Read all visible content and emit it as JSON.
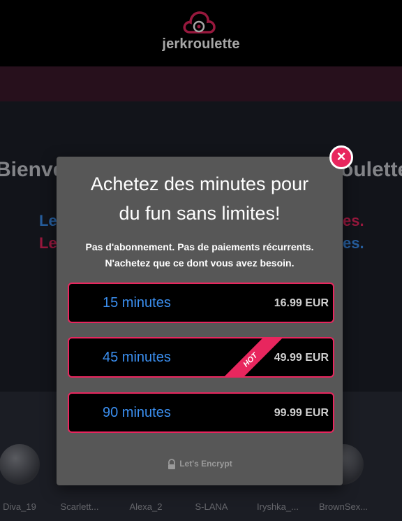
{
  "header": {
    "brand": "jerkroulette"
  },
  "background": {
    "welcome_left": "Bienve",
    "welcome_right": "oulette",
    "lines": [
      {
        "left": "Le",
        "right": "es.",
        "left_color": "#3b8ff0",
        "right_color": "#e8265e"
      },
      {
        "left": "Le",
        "right": "es.",
        "left_color": "#e8265e",
        "right_color": "#3b8ff0"
      }
    ],
    "performers": [
      "Diva_19",
      "Scarlett...",
      "Alexa_2",
      "S-LANA",
      "Iryshka_...",
      "BrownSex..."
    ]
  },
  "modal": {
    "title_line1": "Achetez des minutes pour",
    "title_line2": "du fun sans limites!",
    "subtitle_line1": "Pas d'abonnement. Pas de paiements récurrents.",
    "subtitle_line2": "N'achetez que ce dont vous avez besoin.",
    "close_symbol": "×",
    "plans": [
      {
        "duration": "15 minutes",
        "price": "16.99 EUR"
      },
      {
        "duration": "45 minutes",
        "price": "49.99 EUR",
        "badge": "HOT"
      },
      {
        "duration": "90 minutes",
        "price": "99.99 EUR"
      }
    ],
    "security_badge": "Let's Encrypt"
  },
  "colors": {
    "accent": "#e8265e",
    "link_blue": "#3b8ff0",
    "modal_bg": "#575757",
    "subbar": "#3d1a2c"
  }
}
